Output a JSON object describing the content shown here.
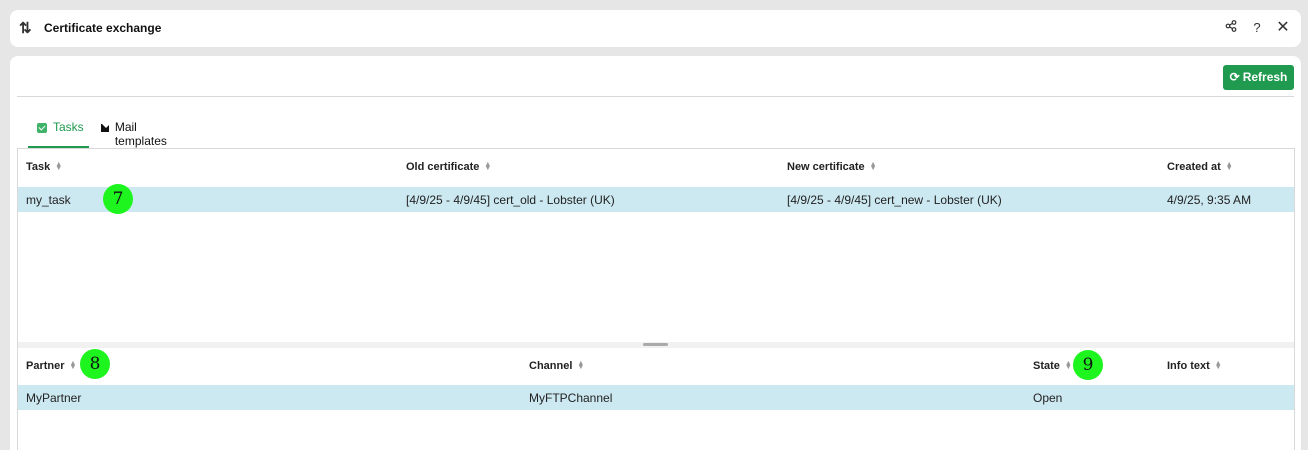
{
  "window": {
    "title": "Certificate exchange",
    "title_icon": "swap-arrows-icon",
    "share_icon": "share-icon",
    "help_label": "?",
    "close_label": "✕"
  },
  "toolbar": {
    "refresh_label": "Refresh",
    "refresh_icon": "refresh-icon"
  },
  "tabs": [
    {
      "label": "Tasks",
      "icon": "checkbox-icon",
      "active": true
    },
    {
      "label": "Mail templates",
      "icon": "envelope-icon",
      "active": false
    }
  ],
  "tasks_table": {
    "columns": [
      "Task",
      "Old certificate",
      "New certificate",
      "Created at"
    ],
    "rows": [
      [
        "my_task",
        "[4/9/25 - 4/9/45] cert_old - Lobster (UK)",
        "[4/9/25 - 4/9/45] cert_new - Lobster (UK)",
        "4/9/25, 9:35 AM"
      ]
    ]
  },
  "partners_table": {
    "columns": [
      "Partner",
      "Channel",
      "State",
      "Info text"
    ],
    "rows": [
      [
        "MyPartner",
        "MyFTPChannel",
        "Open",
        ""
      ]
    ]
  },
  "annotations": [
    "7",
    "8",
    "9"
  ],
  "colors": {
    "accent": "#1f9a4f",
    "selected_row": "#cce8f1",
    "annotation_badge": "#1ef51e"
  }
}
